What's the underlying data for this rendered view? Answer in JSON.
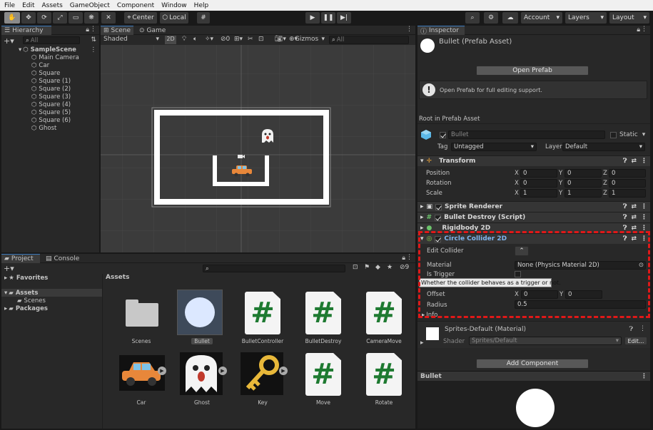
{
  "menu": [
    "File",
    "Edit",
    "Assets",
    "GameObject",
    "Component",
    "Window",
    "Help"
  ],
  "toolbar": {
    "pivot": "Center",
    "space": "Local",
    "account": "Account",
    "layers": "Layers",
    "layout": "Layout"
  },
  "hierarchy": {
    "tab": "Hierarchy",
    "search_placeholder": "All",
    "scene": "SampleScene",
    "items": [
      "Main Camera",
      "Car",
      "Square",
      "Square (1)",
      "Square (2)",
      "Square (3)",
      "Square (4)",
      "Square (5)",
      "Square (6)",
      "Ghost"
    ]
  },
  "scene_view": {
    "tabs": [
      "Scene",
      "Game"
    ],
    "shading": "Shaded",
    "mode_2d": "2D",
    "hidden_count": "0",
    "gizmos": "Gizmos",
    "search_placeholder": "All"
  },
  "project": {
    "tabs": [
      "Project",
      "Console"
    ],
    "favorites": "Favorites",
    "assets_root": "Assets",
    "scenes_folder": "Scenes",
    "packages": "Packages",
    "breadcrumb": "Assets",
    "hidden_count": "9",
    "assets": [
      {
        "name": "Scenes",
        "kind": "folder"
      },
      {
        "name": "Bullet",
        "kind": "circle"
      },
      {
        "name": "BulletController",
        "kind": "script"
      },
      {
        "name": "BulletDestroy",
        "kind": "script"
      },
      {
        "name": "CameraMove",
        "kind": "script"
      },
      {
        "name": "Car",
        "kind": "car"
      },
      {
        "name": "Ghost",
        "kind": "ghost"
      },
      {
        "name": "Key",
        "kind": "key"
      },
      {
        "name": "Move",
        "kind": "script"
      },
      {
        "name": "Rotate",
        "kind": "script"
      }
    ]
  },
  "inspector": {
    "tab": "Inspector",
    "title": "Bullet (Prefab Asset)",
    "open_prefab": "Open Prefab",
    "help_text": "Open Prefab for full editing support.",
    "root_label": "Root in Prefab Asset",
    "object_name": "Bullet",
    "static_label": "Static",
    "tag_label": "Tag",
    "tag_value": "Untagged",
    "layer_label": "Layer",
    "layer_value": "Default",
    "transform": {
      "title": "Transform",
      "position_label": "Position",
      "rotation_label": "Rotation",
      "scale_label": "Scale",
      "position": [
        "0",
        "0",
        "0"
      ],
      "rotation": [
        "0",
        "0",
        "0"
      ],
      "scale": [
        "1",
        "1",
        "1"
      ]
    },
    "axis_labels": [
      "X",
      "Y",
      "Z"
    ],
    "components": [
      "Sprite Renderer",
      "Bullet Destroy (Script)",
      "Rigidbody 2D"
    ],
    "collider": {
      "title": "Circle Collider 2D",
      "edit_label": "Edit Collider",
      "material_label": "Material",
      "material_value": "None (Physics Material 2D)",
      "trigger_label": "Is Trigger",
      "tooltip": "Whether the collider behaves as a trigger or not.",
      "offset_label": "Offset",
      "offset": [
        "0",
        "0"
      ],
      "radius_label": "Radius",
      "radius": "0.5",
      "info_label": "Info"
    },
    "material": {
      "title": "Sprites-Default (Material)",
      "shader_label": "Shader",
      "shader_value": "Sprites/Default",
      "edit_button": "Edit..."
    },
    "add_component": "Add Component",
    "preview_title": "Bullet"
  },
  "colors": {
    "accent": "#3a79bb",
    "highlight_box": "#e01818",
    "script_icon": "#1e7a31"
  }
}
